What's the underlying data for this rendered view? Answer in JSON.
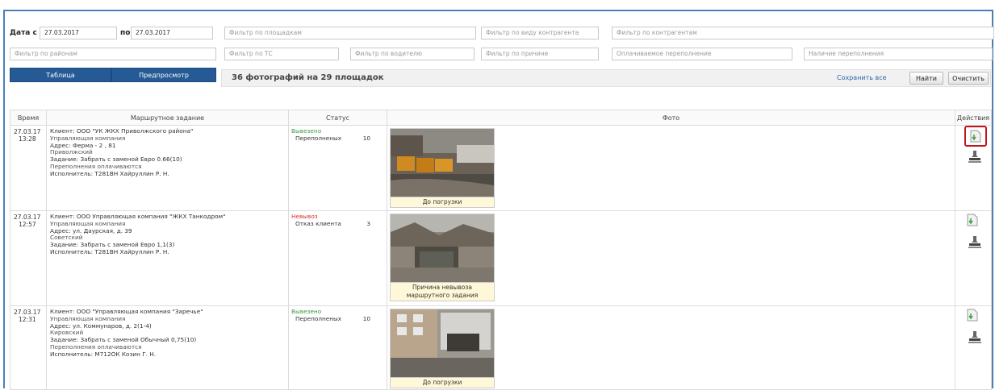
{
  "filters": {
    "date_from_label": "Дата с",
    "date_from_value": "27.03.2017",
    "date_to_label": "по",
    "date_to_value": "27.03.2017",
    "sites_placeholder": "Фильтр по площадкам",
    "contractor_type_placeholder": "Фильтр по виду контрагента",
    "contractors_placeholder": "Фильтр по контрагентам",
    "districts_placeholder": "Фильтр по районам",
    "vehicle_placeholder": "Фильтр по ТС",
    "driver_placeholder": "Фильтр по водителю",
    "reason_placeholder": "Фильтр по причине",
    "paid_overflow_placeholder": "Оплачиваемое переполнение",
    "overflow_presence_placeholder": "Наличие переполнения"
  },
  "view_buttons": {
    "table": "Таблица",
    "preview": "Предпросмотр"
  },
  "summary": {
    "text": "36 фотографий на 29 площадок",
    "save_all": "Сохранить все",
    "find": "Найти",
    "clear": "Очистить"
  },
  "columns": {
    "time": "Время",
    "task": "Маршрутное задание",
    "status": "Статус",
    "photo": "Фото",
    "actions": "Действия"
  },
  "colors": {
    "accent": "#255a95",
    "ok": "#3a9a3a",
    "bad": "#d83030",
    "highlight": "#c0151b"
  },
  "rows": [
    {
      "date": "27.03.17",
      "time": "13:28",
      "client": "Клиент: ООО \"УК ЖКХ Приволжского района\"",
      "type": "Управляющая компания",
      "address": "Адрес: Ферма - 2 , 81",
      "district": "Приволжский",
      "job": "Задание: Забрать с заменой Евро 0.66(10)",
      "overflow": "Переполнения оплачиваются",
      "executor": "Исполнитель: Т281ВН Хайруллин Р. Н.",
      "status": "Вывезено",
      "status_kind": "ok",
      "sub_label": "Переполненых",
      "sub_value": "10",
      "caption": "До погрузки"
    },
    {
      "date": "27.03.17",
      "time": "12:57",
      "client": "Клиент: ООО Управляющая компания \"ЖКХ Танкодром\"",
      "type": "Управляющая компания",
      "address": "Адрес: ул. Даурская, д. 39",
      "district": "Советский",
      "job": "Задание: Забрать с заменой Евро 1,1(3)",
      "overflow": "",
      "executor": "Исполнитель: Т281ВН Хайруллин Р. Н.",
      "status": "Невывоз",
      "status_kind": "bad",
      "sub_label": "Отказ клиента",
      "sub_value": "3",
      "caption": "Причина невывоза маршрутного задания"
    },
    {
      "date": "27.03.17",
      "time": "12:31",
      "client": "Клиент: ООО \"Управляющая компания \"Заречье\"",
      "type": "Управляющая компания",
      "address": "Адрес: ул. Коммунаров, д. 2(1-4)",
      "district": "Кировский",
      "job": "Задание: Забрать с заменой Обычный 0,75(10)",
      "overflow": "Переполнения оплачиваются",
      "executor": "Исполнитель: М712ОК Козин Г. Н.",
      "status": "Вывезено",
      "status_kind": "ok",
      "sub_label": "Переполненых",
      "sub_value": "10",
      "caption": "До погрузки"
    }
  ]
}
